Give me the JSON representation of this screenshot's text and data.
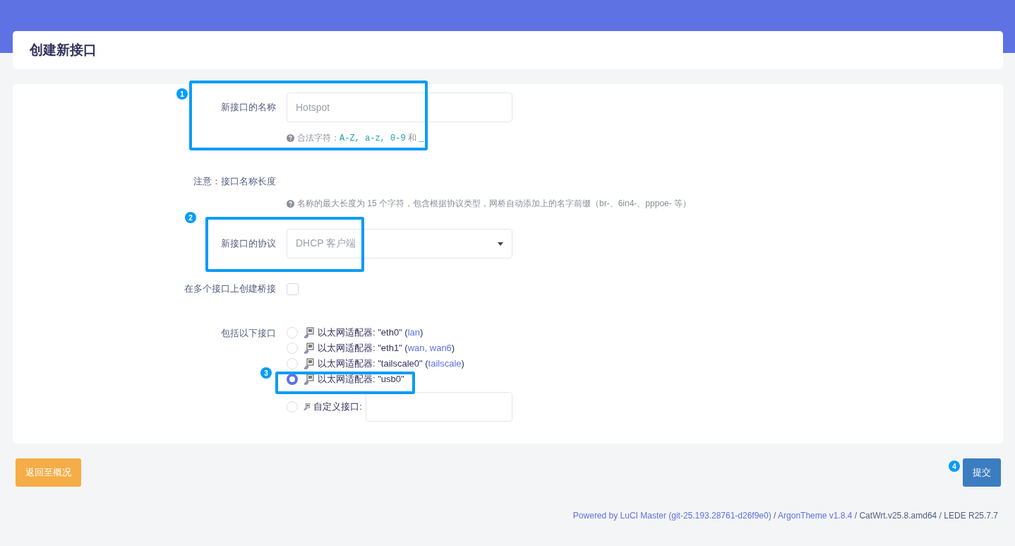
{
  "page_title": "创建新接口",
  "name_field": {
    "label": "新接口的名称",
    "placeholder": "Hotspot",
    "hint": [
      {
        "kind": "text",
        "text": "合法字符："
      },
      {
        "kind": "code",
        "text": "A-Z, a-z, 0-9"
      },
      {
        "kind": "text",
        "text": " 和 "
      },
      {
        "kind": "code",
        "text": "_"
      }
    ]
  },
  "note": {
    "label": "注意：接口名称长度",
    "hint": "名称的最大长度为 15 个字符，包含根据协议类型，网桥自动添加上的名字前缀（br-、6in4-、pppoe- 等）"
  },
  "protocol": {
    "label": "新接口的协议",
    "value": "DHCP 客户端"
  },
  "bridge": {
    "label": "在多个接口上创建桥接",
    "checked": false
  },
  "interfaces": {
    "label": "包括以下接口",
    "items": [
      {
        "kind": "adapter",
        "selected": false,
        "parts": [
          {
            "kind": "text",
            "text": "以太网适配器: \"eth0\" ("
          },
          {
            "kind": "link",
            "text": "lan"
          },
          {
            "kind": "text",
            "text": ")"
          }
        ]
      },
      {
        "kind": "adapter",
        "selected": false,
        "parts": [
          {
            "kind": "text",
            "text": "以太网适配器: \"eth1\" ("
          },
          {
            "kind": "link",
            "text": "wan, wan6"
          },
          {
            "kind": "text",
            "text": ")"
          }
        ]
      },
      {
        "kind": "adapter",
        "selected": false,
        "parts": [
          {
            "kind": "text",
            "text": "以太网适配器: \"tailscale0\" ("
          },
          {
            "kind": "link",
            "text": "tailscale"
          },
          {
            "kind": "text",
            "text": ")"
          }
        ]
      },
      {
        "kind": "adapter",
        "selected": true,
        "parts": [
          {
            "kind": "text",
            "text": "以太网适配器: \"usb0\""
          }
        ]
      },
      {
        "kind": "custom",
        "selected": false,
        "parts": [
          {
            "kind": "text",
            "text": "自定义接口:"
          }
        ]
      }
    ]
  },
  "buttons": {
    "back": "返回至概况",
    "submit": "提交"
  },
  "annotations": [
    {
      "number": "1"
    },
    {
      "number": "2"
    },
    {
      "number": "3"
    },
    {
      "number": "4"
    }
  ],
  "footer": [
    {
      "kind": "link",
      "text": "Powered by LuCI Master (git-25.193.28761-d26f9e0)"
    },
    {
      "kind": "text",
      "text": " / "
    },
    {
      "kind": "link",
      "text": "ArgonTheme v1.8.4"
    },
    {
      "kind": "text",
      "text": " / CatWrt.v25.8.amd64 / LEDE R25.7.7"
    }
  ]
}
